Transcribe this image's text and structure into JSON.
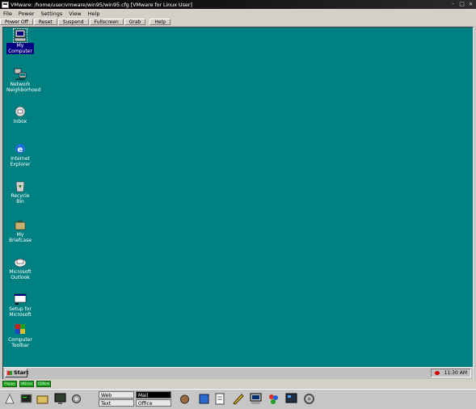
{
  "window": {
    "title": "VMware: /home/user/vmware/win95/win95.cfg [VMware for Linux User]",
    "controls": [
      "-",
      "□",
      "×"
    ]
  },
  "menu": [
    "File",
    "Power",
    "Settings",
    "View",
    "Help"
  ],
  "toolbar": {
    "buttons": [
      "Power Off",
      "Reset",
      "Suspend",
      "Fullscreen",
      "Grab",
      "Help"
    ]
  },
  "desktop": {
    "icons": [
      {
        "label": "My\nComputer",
        "icon": "my-computer-icon",
        "selected": true
      },
      {
        "label": "Network\nNeighborhood",
        "icon": "network-neighborhood-icon"
      },
      {
        "label": "Inbox",
        "icon": "inbox-icon"
      },
      {
        "label": "Internet\nExplorer",
        "icon": "internet-explorer-icon"
      },
      {
        "label": "Recycle\nBin",
        "icon": "recycle-bin-icon"
      },
      {
        "label": "My\nBriefcase",
        "icon": "briefcase-icon"
      },
      {
        "label": "Microsoft\nOutlook",
        "icon": "outlook-icon"
      },
      {
        "label": "Setup for\nMicrosoft",
        "icon": "setup-icon"
      },
      {
        "label": "Computer\nToolbar",
        "icon": "toolbar-icon"
      }
    ],
    "background": "#008080"
  },
  "taskbar": {
    "start_label": "Start",
    "clock": "11:30 AM"
  },
  "status": {
    "leds": [
      "Floppy",
      "HDrive",
      "CDRom"
    ]
  },
  "panel": {
    "pager": {
      "cells": [
        "Web",
        "Mail",
        "Text",
        "Office"
      ],
      "active_index": 1
    }
  }
}
